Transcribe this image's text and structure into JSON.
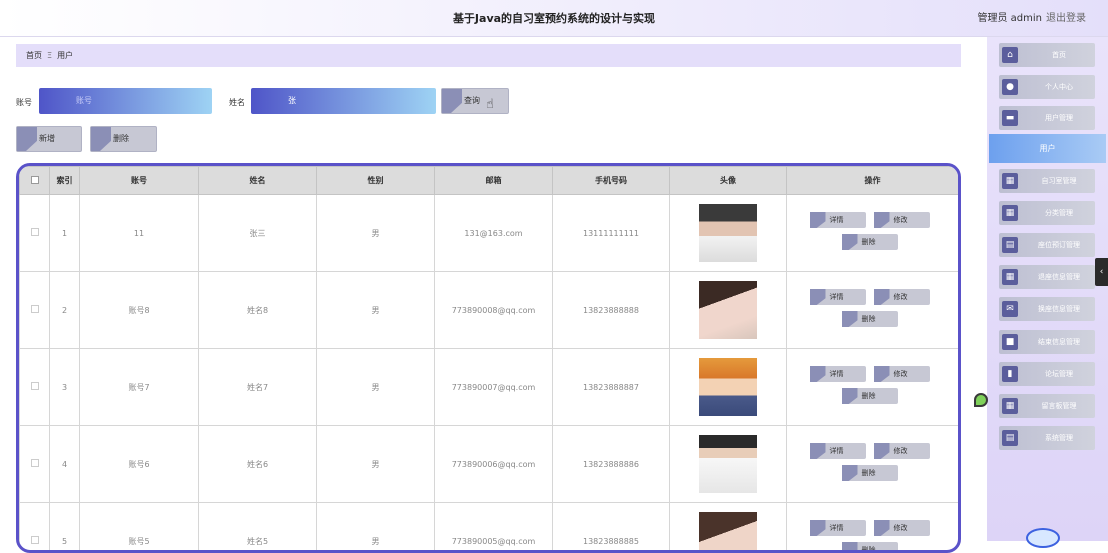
{
  "header": {
    "title": "基于Java的自习室预约系统的设计与实现",
    "user_label": "管理员 admin",
    "logout_label": "退出登录"
  },
  "breadcrumb": {
    "home": "首页",
    "separator": "Ξ",
    "current": "用户"
  },
  "search": {
    "account_label": "账号",
    "account_placeholder": "账号",
    "name_label": "姓名",
    "name_value": "张",
    "query_button": "查询"
  },
  "actions": {
    "add_button": "新增",
    "delete_button": "删除"
  },
  "table": {
    "columns": [
      "索引",
      "账号",
      "姓名",
      "性别",
      "邮箱",
      "手机号码",
      "头像",
      "操作"
    ],
    "op_labels": {
      "detail": "详情",
      "edit": "修改",
      "delete": "删除"
    },
    "rows": [
      {
        "index": "1",
        "account": "11",
        "name": "张三",
        "gender": "男",
        "email": "131@163.com",
        "phone": "13111111111"
      },
      {
        "index": "2",
        "account": "账号8",
        "name": "姓名8",
        "gender": "男",
        "email": "773890008@qq.com",
        "phone": "13823888888"
      },
      {
        "index": "3",
        "account": "账号7",
        "name": "姓名7",
        "gender": "男",
        "email": "773890007@qq.com",
        "phone": "13823888887"
      },
      {
        "index": "4",
        "account": "账号6",
        "name": "姓名6",
        "gender": "男",
        "email": "773890006@qq.com",
        "phone": "13823888886"
      },
      {
        "index": "5",
        "account": "账号5",
        "name": "姓名5",
        "gender": "男",
        "email": "773890005@qq.com",
        "phone": "13823888885"
      }
    ]
  },
  "sidebar": {
    "items": [
      {
        "label": "首页",
        "icon": "home-icon"
      },
      {
        "label": "个人中心",
        "icon": "user-icon"
      },
      {
        "label": "用户管理",
        "icon": "folder-icon"
      },
      {
        "label": "用户",
        "active": true
      },
      {
        "label": "自习室管理",
        "icon": "grid-icon"
      },
      {
        "label": "分类管理",
        "icon": "grid-icon"
      },
      {
        "label": "座位预订管理",
        "icon": "document-icon"
      },
      {
        "label": "退座信息管理",
        "icon": "table-icon"
      },
      {
        "label": "换座信息管理",
        "icon": "message-icon"
      },
      {
        "label": "结束信息管理",
        "icon": "chat-icon"
      },
      {
        "label": "论坛管理",
        "icon": "book-icon"
      },
      {
        "label": "留言板管理",
        "icon": "grid-icon"
      },
      {
        "label": "系统管理",
        "icon": "document-icon"
      }
    ]
  },
  "colors": {
    "accent": "#5a52c9",
    "sidebar_bg": "#e4dcfa",
    "active_nav": "#7aa8f0"
  }
}
